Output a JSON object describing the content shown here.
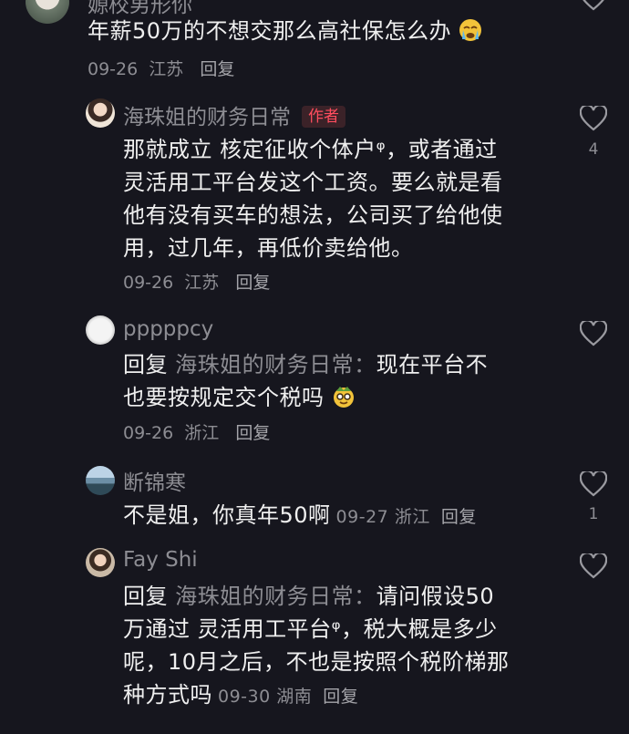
{
  "top_comment": {
    "name": "嫄校男形你",
    "text": "年薪50万的不想交那么高社保怎么办",
    "date": "09-26",
    "location": "江苏",
    "reply_label": "回复",
    "emoji_icon": "crying-face-icon"
  },
  "replies": [
    {
      "name": "海珠姐的财务日常",
      "badge": "作者",
      "lines": [
        "那就成立 核定征收个体户ᵠ，或者通过",
        "灵活用工平台发这个工资。要么就是看",
        "他有没有买车的想法，公司买了给他使",
        "用，过几年，再低价卖给他。"
      ],
      "date": "09-26",
      "location": "江苏",
      "reply_label": "回复",
      "likes": "4"
    },
    {
      "name": "pppppcy",
      "reply_prefix": "回复",
      "reply_target": "海珠姐的财务日常：",
      "line1_rest": "现在平台不",
      "line2": "也要按规定交个税吗",
      "emoji_icon": "glasses-face-icon",
      "date": "09-26",
      "location": "浙江",
      "reply_label": "回复",
      "likes": ""
    },
    {
      "name": "断锦寒",
      "text": "不是姐，你真年50啊",
      "date": "09-27",
      "location": "浙江",
      "reply_label": "回复",
      "likes": "1"
    },
    {
      "name": "Fay Shi",
      "reply_prefix": "回复",
      "reply_target": "海珠姐的财务日常：",
      "line1_rest": "请问假设50",
      "line2": "万通过 灵活用工平台ᵠ，税大概是多少",
      "line3": "呢，10月之后，不也是按照个税阶梯那",
      "line4": "种方式吗",
      "date": "09-30",
      "location": "湖南",
      "reply_label": "回复",
      "likes": ""
    }
  ],
  "colors": {
    "background": "#16161e",
    "text": "#efefef",
    "secondary": "#8d8d93",
    "author_badge": "#ff4d5e"
  }
}
